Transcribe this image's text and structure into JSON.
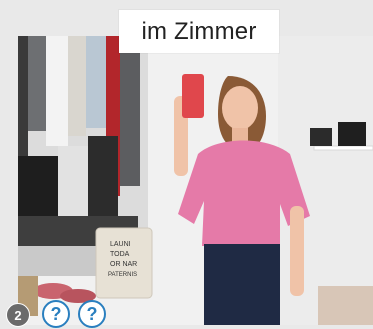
{
  "title": "im Zimmer",
  "badge": {
    "number": "2"
  },
  "help_buttons": [
    {
      "label": "?"
    },
    {
      "label": "?"
    }
  ],
  "bag_text": [
    "LAUNI",
    "TODA",
    "OR NAR",
    "PATERNIS"
  ],
  "colors": {
    "accent": "#2a7fbf",
    "badge": "#6b6b6b",
    "shirt": "#e57aa8",
    "wall": "#f2f2f2"
  },
  "icons": {
    "help": "question-mark-icon"
  }
}
